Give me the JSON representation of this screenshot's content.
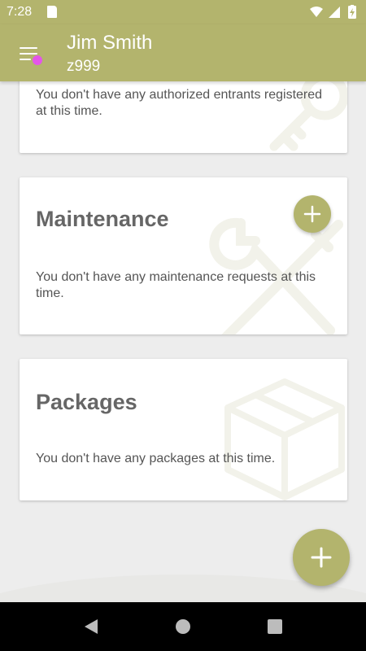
{
  "status_bar": {
    "time": "7:28",
    "icons": [
      "sd-card-icon",
      "wifi-icon",
      "signal-icon",
      "battery-charging-icon"
    ]
  },
  "header": {
    "menu_icon": "menu-icon",
    "notification_dot_color": "#e455e9",
    "user_name": "Jim Smith",
    "user_id": "z999"
  },
  "cards": [
    {
      "id": "authorized-entrants",
      "title": "",
      "empty_text": "You don't have any authorized entrants registered at this time.",
      "watermark_icon": "key-icon"
    },
    {
      "id": "maintenance",
      "title": "Maintenance",
      "empty_text": "You don't have any maintenance requests at this time.",
      "watermark_icon": "wrench-screwdriver-icon",
      "add_button": "plus-icon"
    },
    {
      "id": "packages",
      "title": "Packages",
      "empty_text": "You don't have any packages at this time.",
      "watermark_icon": "package-box-icon"
    }
  ],
  "fab": {
    "icon": "plus-icon"
  },
  "nav_bar": {
    "buttons": [
      "back-icon",
      "home-icon",
      "recents-icon"
    ]
  },
  "colors": {
    "accent": "#b3b46d",
    "background": "#ededed",
    "card": "#ffffff",
    "title_text": "#666666",
    "body_text": "#555555"
  }
}
